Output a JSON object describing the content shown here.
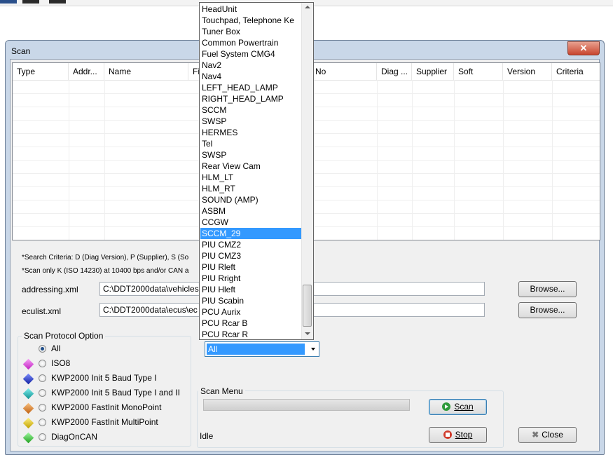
{
  "window": {
    "title": "Scan",
    "close_glyph": "✕"
  },
  "table": {
    "columns": [
      "Type",
      "Addr...",
      "Name",
      "Fi",
      "No",
      "Diag ...",
      "Supplier",
      "Soft",
      "Version",
      "Criteria"
    ]
  },
  "notes": {
    "search_criteria": "*Search Criteria: D (Diag Version), P (Supplier), S (So",
    "scan_only": "*Scan only K (ISO 14230) at 10400 bps and/or CAN a"
  },
  "files": {
    "addressing_label": "addressing.xml",
    "addressing_value": "C:\\DDT2000data\\vehicles",
    "eculist_label": "eculist.xml",
    "eculist_value": "C:\\DDT2000data\\ecus\\ec",
    "browse_label": "Browse..."
  },
  "protocol": {
    "title": "Scan Protocol Option",
    "options": [
      {
        "label": "All",
        "selected": true,
        "color": ""
      },
      {
        "label": "ISO8",
        "selected": false,
        "color": "#e040e0"
      },
      {
        "label": "KWP2000 Init 5 Baud Type I",
        "selected": false,
        "color": "#3040c0"
      },
      {
        "label": "KWP2000 Init 5 Baud Type I and II",
        "selected": false,
        "color": "#20c0c0"
      },
      {
        "label": "KWP2000 FastInit MonoPoint",
        "selected": false,
        "color": "#e08020"
      },
      {
        "label": "KWP2000 FastInit MultiPoint",
        "selected": false,
        "color": "#e0c000"
      },
      {
        "label": "DiagOnCAN",
        "selected": false,
        "color": "#40d040"
      }
    ]
  },
  "combo": {
    "value": "All"
  },
  "dropdown": {
    "items": [
      "HeadUnit",
      "Touchpad, Telephone Ke",
      "Tuner Box",
      "Common Powertrain",
      "Fuel System CMG4",
      "Nav2",
      "Nav4",
      "LEFT_HEAD_LAMP",
      "RIGHT_HEAD_LAMP",
      "SCCM",
      "SWSP",
      "HERMES",
      "Tel",
      "SWSP",
      "Rear View Cam",
      "HLM_LT",
      "HLM_RT",
      "SOUND (AMP)",
      "ASBM",
      "CCGW",
      "SCCM_29",
      "PIU CMZ2",
      "PIU CMZ3",
      "PIU Rleft",
      "PIU Rright",
      "PIU Hleft",
      "PIU Scabin",
      "PCU Aurix",
      "PCU Rcar B",
      "PCU Rcar R"
    ],
    "highlighted": "SCCM_29"
  },
  "scan_menu": {
    "title": "Scan Menu",
    "status": "Idle",
    "progress": 0,
    "scan_label": "Scan",
    "stop_label": "Stop",
    "close_label": "Close"
  },
  "colors": {
    "accent": "#3399ff",
    "scan_icon": "#2e9a3a",
    "stop_icon": "#d03a2a"
  }
}
